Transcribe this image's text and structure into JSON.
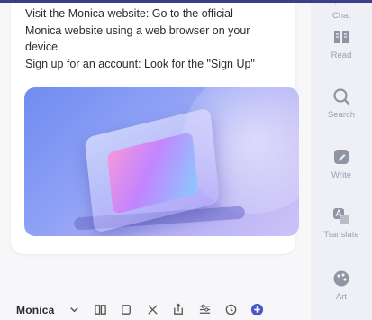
{
  "content": {
    "lines": [
      "Visit the Monica website: Go to the official",
      "Monica website using a web browser on your",
      "device.",
      "Sign up for an account: Look for the \"Sign Up\""
    ]
  },
  "sidebar": {
    "items": [
      {
        "label": "Chat",
        "icon": "chat-icon"
      },
      {
        "label": "Read",
        "icon": "book-icon"
      },
      {
        "label": "Search",
        "icon": "search-icon"
      },
      {
        "label": "Write",
        "icon": "pen-icon"
      },
      {
        "label": "Translate",
        "icon": "translate-icon"
      },
      {
        "label": "Art",
        "icon": "art-icon"
      }
    ]
  },
  "toolbar": {
    "brand": "Monica",
    "icons": [
      "chevron-down-icon",
      "book-icon",
      "copy-icon",
      "close-icon",
      "share-icon",
      "settings-icon",
      "history-icon",
      "add-icon"
    ]
  },
  "colors": {
    "accent": "#4a55c8",
    "sidebar_bg": "#eef0f6",
    "icon_gray": "#9aa0ad"
  }
}
